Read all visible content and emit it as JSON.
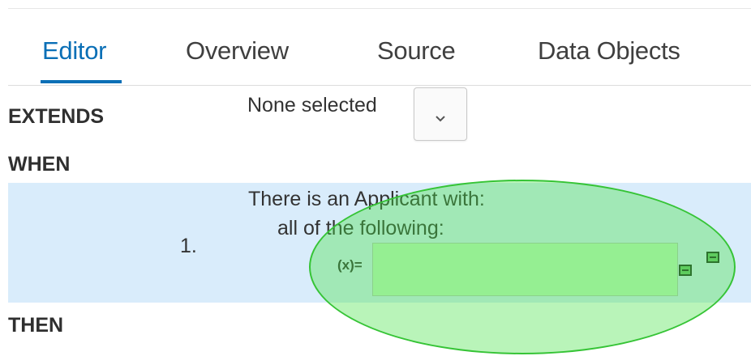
{
  "tabs": [
    {
      "label": "Editor",
      "active": true
    },
    {
      "label": "Overview",
      "active": false
    },
    {
      "label": "Source",
      "active": false
    },
    {
      "label": "Data Objects",
      "active": false
    }
  ],
  "rule": {
    "extends_label": "EXTENDS",
    "extends_value": "None selected",
    "when_label": "WHEN",
    "then_label": "THEN",
    "condition": {
      "number": "1.",
      "fact_text": "There is an Applicant with:",
      "constraint_text": "all of the following:",
      "variable_label": "(x)=",
      "value": ""
    }
  },
  "icons": {
    "dropdown": "chevron-down-icon",
    "remove": "remove-field-icon",
    "remove_pattern": "remove-pattern-icon"
  },
  "colors": {
    "accent": "#0a6fb6",
    "row_highlight": "#d9ecfb",
    "input_fill": "#c6f7c0",
    "annotation_ellipse": "#46e146"
  }
}
